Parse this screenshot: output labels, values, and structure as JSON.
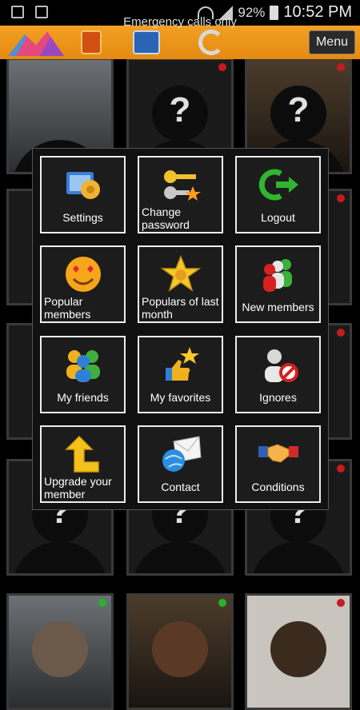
{
  "status_bar": {
    "emergency": "Emergency calls only",
    "battery": "92%",
    "time": "10:52 PM"
  },
  "toolbar": {
    "menu_label": "Menu"
  },
  "menu": {
    "items": [
      {
        "label": "Settings",
        "icon": "settings-icon"
      },
      {
        "label": "Change password",
        "icon": "keys-icon"
      },
      {
        "label": "Logout",
        "icon": "logout-arrow-icon"
      },
      {
        "label": "Popular members",
        "icon": "heart-eyes-smiley-icon"
      },
      {
        "label": "Populars of last month",
        "icon": "star-badge-icon"
      },
      {
        "label": "New members",
        "icon": "people-group-icon"
      },
      {
        "label": "My friends",
        "icon": "friends-icon"
      },
      {
        "label": "My favorites",
        "icon": "thumbs-up-star-icon"
      },
      {
        "label": "Ignores",
        "icon": "blocked-user-icon"
      },
      {
        "label": "Upgrade your member",
        "icon": "upgrade-arrow-icon"
      },
      {
        "label": "Contact",
        "icon": "envelope-globe-icon"
      },
      {
        "label": "Conditions",
        "icon": "handshake-icon"
      }
    ]
  },
  "colors": {
    "toolbar": "#e8920f",
    "popup_border": "#ededed",
    "offline_dot": "#c41c1c",
    "online_dot": "#28b428"
  }
}
